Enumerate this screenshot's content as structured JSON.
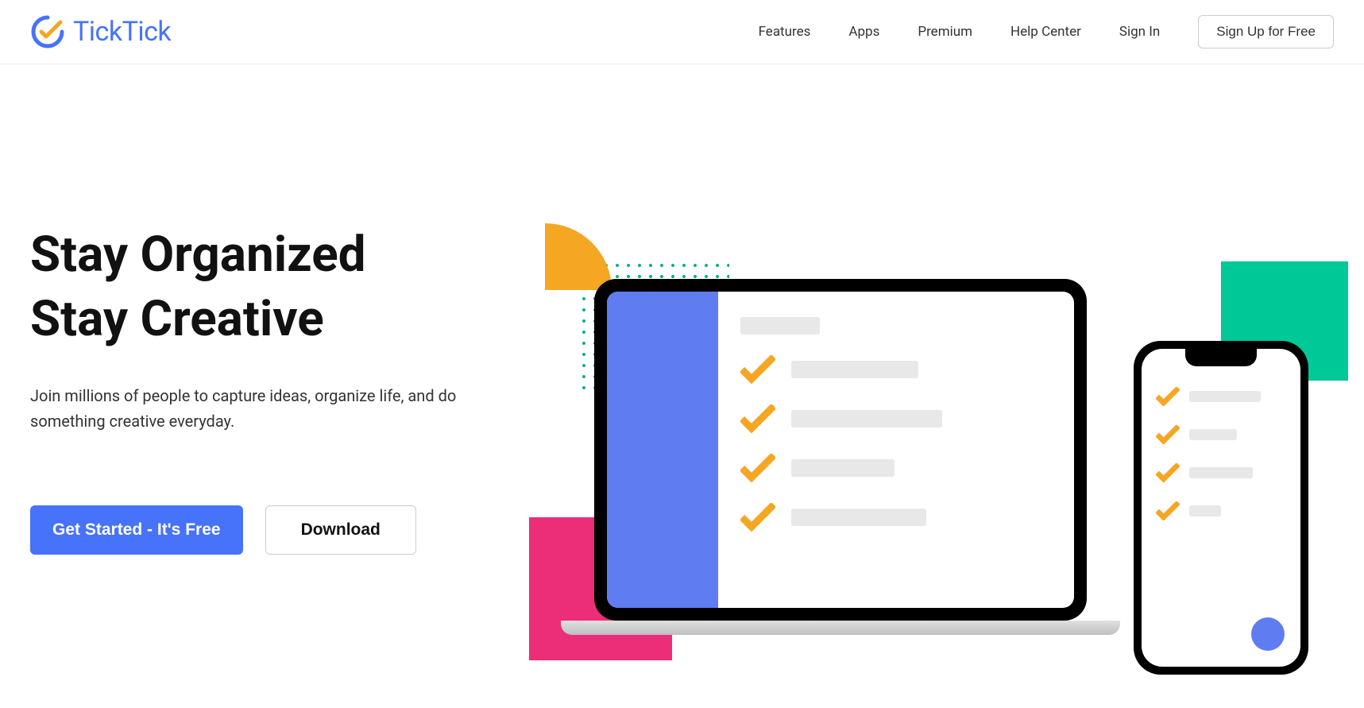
{
  "brand": {
    "name": "TickTick"
  },
  "nav": {
    "features": "Features",
    "apps": "Apps",
    "premium": "Premium",
    "help_center": "Help Center",
    "sign_in": "Sign In",
    "sign_up": "Sign Up for Free"
  },
  "hero": {
    "title_line1": "Stay Organized",
    "title_line2": "Stay Creative",
    "subtitle": "Join millions of people to capture ideas, organize life, and do something creative everyday.",
    "get_started": "Get Started - It's Free",
    "download": "Download"
  },
  "colors": {
    "primary": "#4772fa",
    "accent_orange": "#f5a623",
    "accent_green": "#00c896",
    "accent_pink": "#ec2d77"
  }
}
